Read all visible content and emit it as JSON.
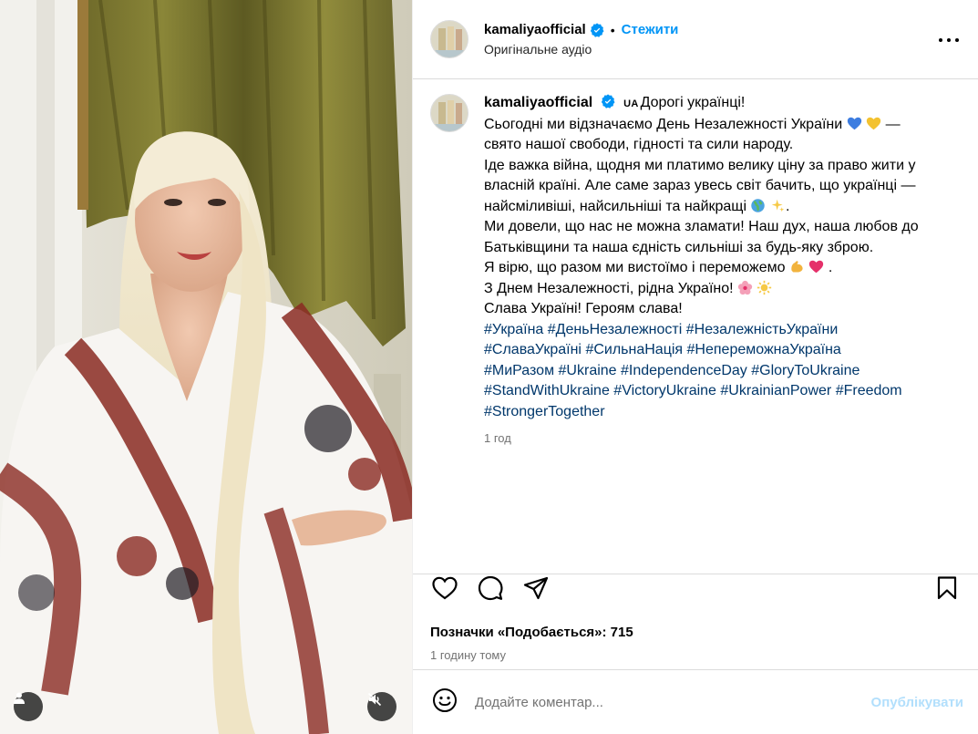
{
  "post": {
    "username": "kamaliyaofficial",
    "separator": "•",
    "follow_label": "Стежити",
    "audio_label": "Оригінальне аудіо",
    "more_icon": "more-horizontal-icon"
  },
  "caption": {
    "username": "kamaliyaofficial",
    "flag_text": "UA",
    "greeting": "Дорогі українці!",
    "line1": "Сьогодні ми відзначаємо День Незалежності України",
    "line1_end": "—",
    "line2": "свято нашої свободи, гідності та сили народу.",
    "line3": "Іде важка війна, щодня ми платимо велику ціну за право жити у власній країні. Але саме зараз увесь світ бачить, що українці — найсміливіші, найсильніші та найкращі",
    "line4": "Ми довели, що нас не можна зламати! Наш дух, наша любов до Батьківщини та наша єдність сильніші за будь-яку зброю.",
    "line5": "Я вірю, що разом ми вистоїмо і переможемо",
    "line5_end": ".",
    "line6": "З Днем Незалежності, рідна Україно!",
    "line7": "Слава Україні! Героям слава!",
    "hashtags": [
      "#Україна",
      "#ДеньНезалежності",
      "#НезалежністьУкраїни",
      "#СлаваУкраїні",
      "#СильнаНація",
      "#НепереможнаУкраїна",
      "#МиРазом",
      "#Ukraine",
      "#IndependenceDay",
      "#GloryToUkraine",
      "#StandWithUkraine",
      "#VictoryUkraine",
      "#UkrainianPower",
      "#Freedom",
      "#StrongerTogether"
    ],
    "time_ago": "1 год"
  },
  "actions": {
    "likes_text": "Позначки «Подобається»: 715",
    "date_text": "1 годину тому"
  },
  "comment": {
    "placeholder": "Додайте коментар...",
    "publish_label": "Опублікувати"
  },
  "colors": {
    "link_blue": "#0095f6",
    "hashtag": "#00376b",
    "muted": "#737373",
    "publish_disabled": "#b2dffc"
  }
}
